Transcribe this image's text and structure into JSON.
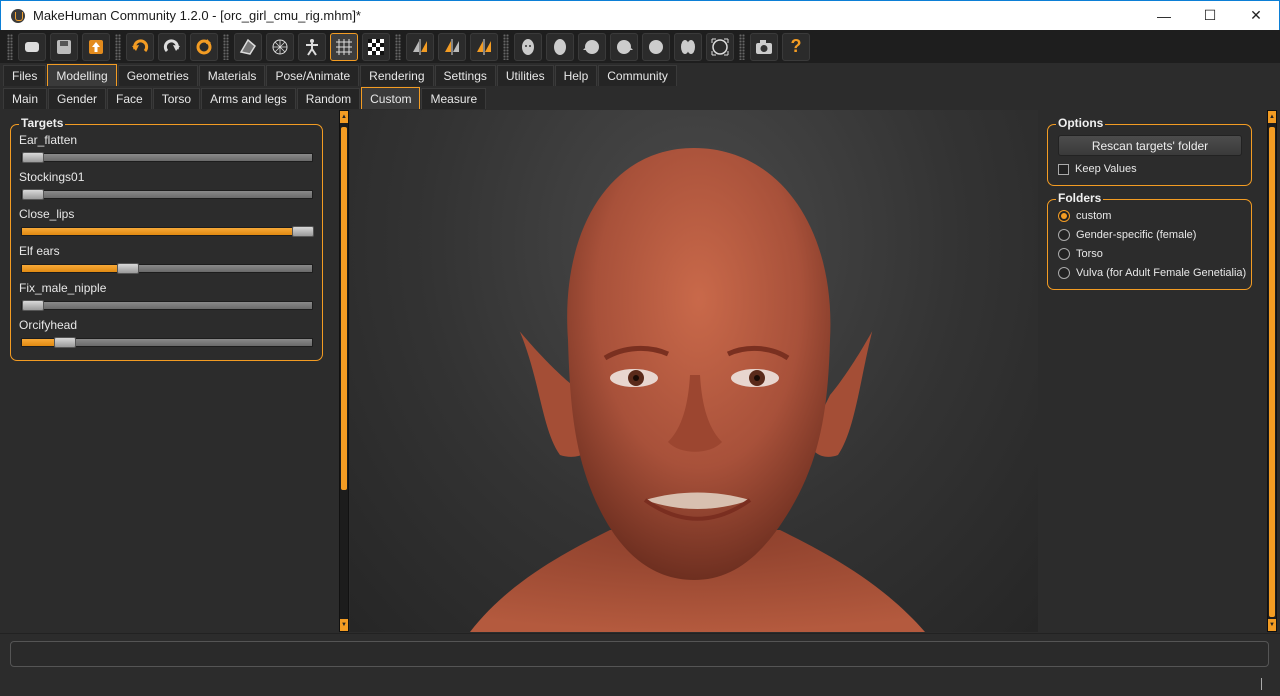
{
  "window": {
    "title": "MakeHuman Community 1.2.0 - [orc_girl_cmu_rig.mhm]*",
    "minimize": "—",
    "maximize": "☐",
    "close": "✕"
  },
  "toolbar": {
    "buttons": [
      "new-icon",
      "save-icon",
      "export-icon",
      "undo-icon",
      "redo-icon",
      "reset-icon",
      "pose-icon",
      "wireframe-icon",
      "skeleton-icon",
      "grid-icon",
      "checker-icon",
      "symmetry-right-icon",
      "symmetry-left-icon",
      "symmetry-icon",
      "front-view-icon",
      "back-view-icon",
      "left-view-icon",
      "right-view-icon",
      "top-view-icon",
      "bottom-view-icon",
      "reset-camera-icon",
      "screenshot-icon",
      "help-icon"
    ],
    "help_label": "?"
  },
  "main_tabs": [
    "Files",
    "Modelling",
    "Geometries",
    "Materials",
    "Pose/Animate",
    "Rendering",
    "Settings",
    "Utilities",
    "Help",
    "Community"
  ],
  "main_tab_active": "Modelling",
  "sub_tabs": [
    "Main",
    "Gender",
    "Face",
    "Torso",
    "Arms and legs",
    "Random",
    "Custom",
    "Measure"
  ],
  "sub_tab_active": "Custom",
  "targets": {
    "title": "Targets",
    "sliders": [
      {
        "label": "Ear_flatten",
        "value": 0.0
      },
      {
        "label": "Stockings01",
        "value": 0.0
      },
      {
        "label": "Close_lips",
        "value": 1.0
      },
      {
        "label": "Elf ears",
        "value": 0.35
      },
      {
        "label": "Fix_male_nipple",
        "value": 0.0
      },
      {
        "label": "Orcifyhead",
        "value": 0.12
      }
    ]
  },
  "options": {
    "title": "Options",
    "rescan_label": "Rescan targets' folder",
    "keep_values_label": "Keep Values",
    "keep_values_checked": false
  },
  "folders": {
    "title": "Folders",
    "items": [
      "custom",
      "Gender-specific (female)",
      "Torso",
      "Vulva (for Adult Female Genetialia)"
    ],
    "selected": "custom"
  },
  "colors": {
    "accent": "#f39c23",
    "skin": "#b55a3c",
    "background": "#2c2c2c"
  }
}
